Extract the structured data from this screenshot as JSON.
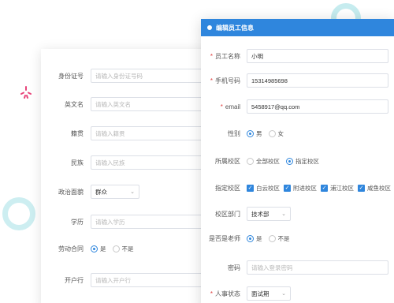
{
  "back_form": {
    "fields": [
      {
        "label": "身份证号",
        "type": "input",
        "placeholder": "请输入身份证号码"
      },
      {
        "label": "英文名",
        "type": "input",
        "placeholder": "请输入英文名"
      },
      {
        "label": "籍贯",
        "type": "input",
        "placeholder": "请输入籍贯"
      },
      {
        "label": "民族",
        "type": "input",
        "placeholder": "请输入民族"
      },
      {
        "label": "政治面貌",
        "type": "select",
        "value": "群众"
      },
      {
        "label": "学历",
        "type": "input",
        "placeholder": "请输入学历"
      },
      {
        "label": "劳动合同",
        "type": "radio",
        "options": [
          "是",
          "不是"
        ],
        "selected": "是"
      },
      {
        "label": "开户行",
        "type": "input",
        "placeholder": "请输入开户行"
      }
    ]
  },
  "front_form": {
    "title": "编辑员工信息",
    "accent_color": "#2f86dd",
    "name": {
      "label": "员工名称",
      "value": "小明",
      "required": true
    },
    "phone": {
      "label": "手机号码",
      "value": "15314985698",
      "required": true
    },
    "email": {
      "label": "email",
      "value": "5458917@qq.com",
      "required": true
    },
    "gender": {
      "label": "性别",
      "options": [
        "男",
        "女"
      ],
      "selected": "男"
    },
    "campus_scope": {
      "label": "所属校区",
      "options": [
        "全部校区",
        "指定校区"
      ],
      "selected": "指定校区"
    },
    "campuses": {
      "label": "指定校区",
      "options": [
        "白云校区",
        "附进校区",
        "浦江校区",
        "咸鱼校区"
      ],
      "checked": [
        "白云校区",
        "附进校区",
        "浦江校区",
        "咸鱼校区"
      ]
    },
    "department": {
      "label": "校区部门",
      "value": "技术部"
    },
    "is_teacher": {
      "label": "是否是老师",
      "options": [
        "是",
        "不是"
      ],
      "selected": "是"
    },
    "password": {
      "label": "密码",
      "placeholder": "请输入登录密码"
    },
    "hr_status": {
      "label": "人事状态",
      "value": "面试期",
      "required": true
    }
  }
}
